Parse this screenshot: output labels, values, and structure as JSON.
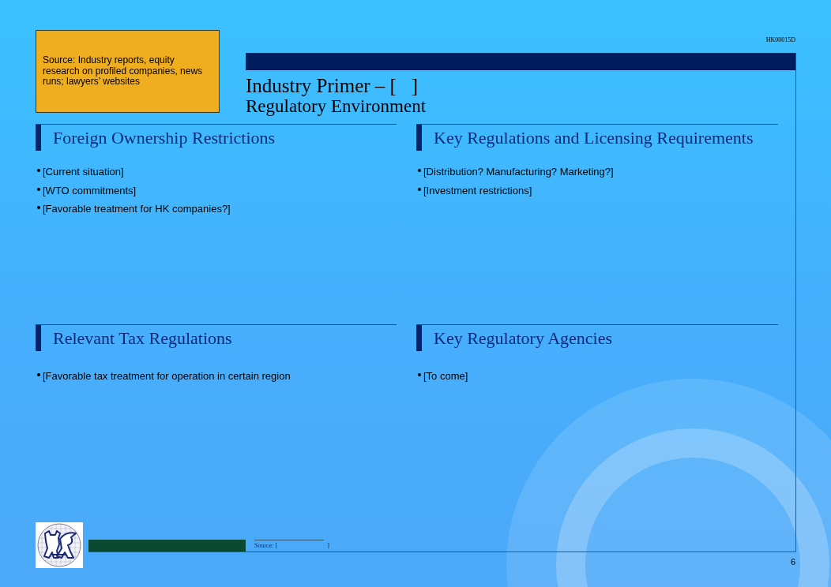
{
  "document_code": "HK00015D",
  "note": {
    "text": "Source: Industry reports, equity research on profiled companies, news runs; lawyers’ websites"
  },
  "title": "Industry Primer – [   ]",
  "subtitle": "Regulatory Environment",
  "sections": [
    {
      "heading": "Foreign Ownership Restrictions",
      "bullets": [
        "[Current situation]",
        "[WTO commitments]",
        "[Favorable treatment for HK companies?]"
      ]
    },
    {
      "heading": "Key Regulations and Licensing Requirements",
      "bullets": [
        "[Distribution? Manufacturing? Marketing?]",
        "[Investment restrictions]"
      ]
    },
    {
      "heading": "Relevant Tax Regulations",
      "bullets": [
        "[Favorable tax treatment for operation in certain region"
      ]
    },
    {
      "heading": "Key Regulatory Agencies",
      "bullets": [
        "[To come]"
      ]
    }
  ],
  "footer": {
    "source_label": "Source: [",
    "source_end": "]",
    "page_number": "6"
  }
}
